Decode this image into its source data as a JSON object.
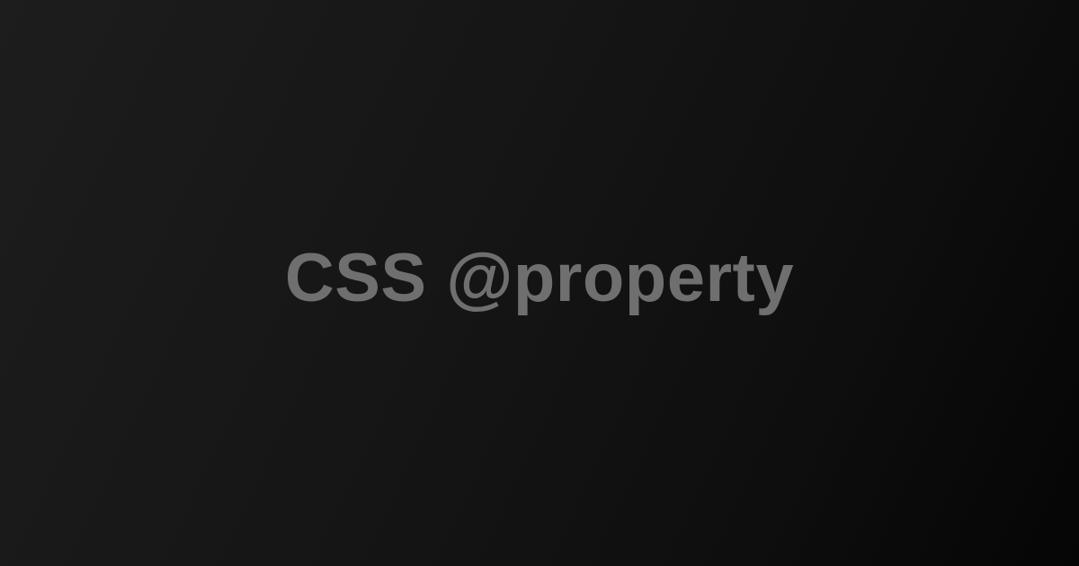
{
  "title": "CSS @property",
  "colors": {
    "text": "#6f6f6f",
    "background_start": "#1d1d1d",
    "background_end": "#050505"
  }
}
